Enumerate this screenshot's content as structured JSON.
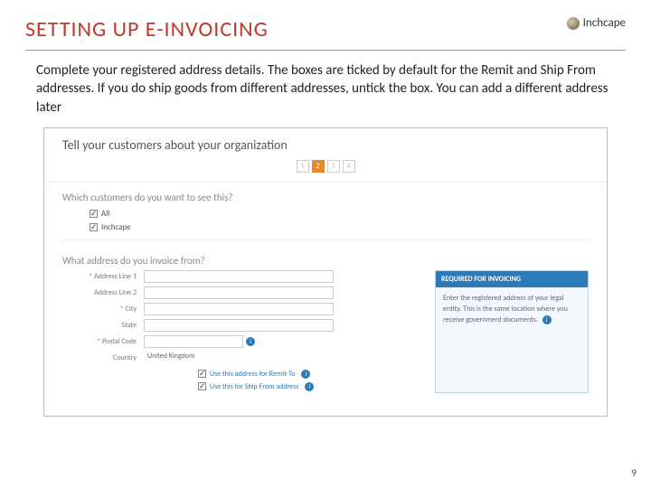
{
  "header": {
    "title": "SETTING UP E-INVOICING",
    "logo_text": "Inchcape"
  },
  "instructions": "Complete your registered address details. The boxes are ticked by default for the Remit and Ship From addresses.  If you do ship goods from different addresses, untick the box.  You can add a different address later",
  "form": {
    "title": "Tell your customers about your organization",
    "steps": [
      "1",
      "2",
      "3",
      "4"
    ],
    "q1": "Which customers do you want to see this?",
    "chk_all": "All",
    "chk_inchcape": "Inchcape",
    "q2": "What address do you invoice from?",
    "fields": {
      "addr1": "* Address Line 1",
      "addr2": "Address Line 2",
      "city": "* City",
      "state": "State",
      "postal": "* Postal Code",
      "country": "Country",
      "country_value": "United Kingdom"
    },
    "callout": {
      "head": "REQUIRED FOR INVOICING",
      "body": "Enter the registered address of your legal entity. This is the same location where you receive government documents."
    },
    "remit_label": "Use this address for Remit-To",
    "ship_label": "Use this for Ship From address"
  },
  "page_number": "9"
}
